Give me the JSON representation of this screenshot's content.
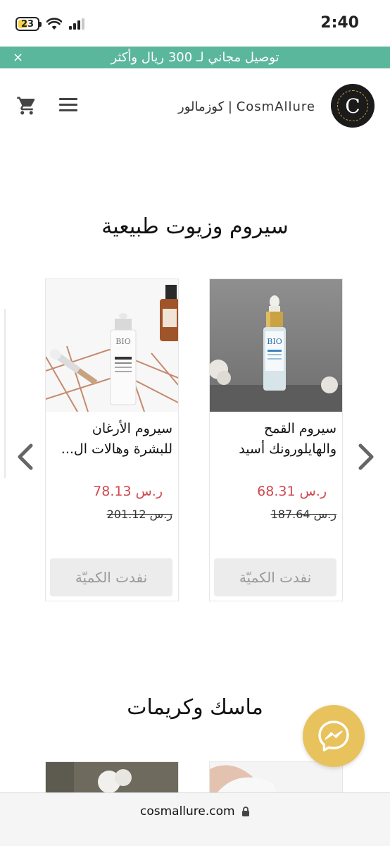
{
  "status_bar": {
    "battery": "23",
    "time": "2:40"
  },
  "announcement": {
    "text": "توصيل مجاني لـ 300 ريال وأكثر",
    "close_label": "×"
  },
  "header": {
    "brand": "كوزمالور | CosmAllure"
  },
  "sections": [
    {
      "title": "سيروم وزيوت طبيعية",
      "products": [
        {
          "name_line1": "سيروم القمح",
          "name_line2": "والهايلورونك أسيد",
          "price": "ر.س 68.31",
          "old_price": "ر.س 187.64",
          "button": "نفدت الكميّة",
          "image_icon": "serum-bottle-image"
        },
        {
          "name_line1": "سيروم الأرغان",
          "name_line2": "للبشرة وهالات ال...",
          "price": "ر.س 78.13",
          "old_price": "ر.س 201.12",
          "button": "نفدت الكميّة",
          "image_icon": "argan-serum-image"
        }
      ]
    },
    {
      "title": "ماسك وكريمات"
    }
  ],
  "browser": {
    "url": "cosmallure.com"
  },
  "colors": {
    "accent_green": "#5bb79b",
    "sale_red": "#d0484f",
    "messenger_yellow": "#e8c25c"
  }
}
